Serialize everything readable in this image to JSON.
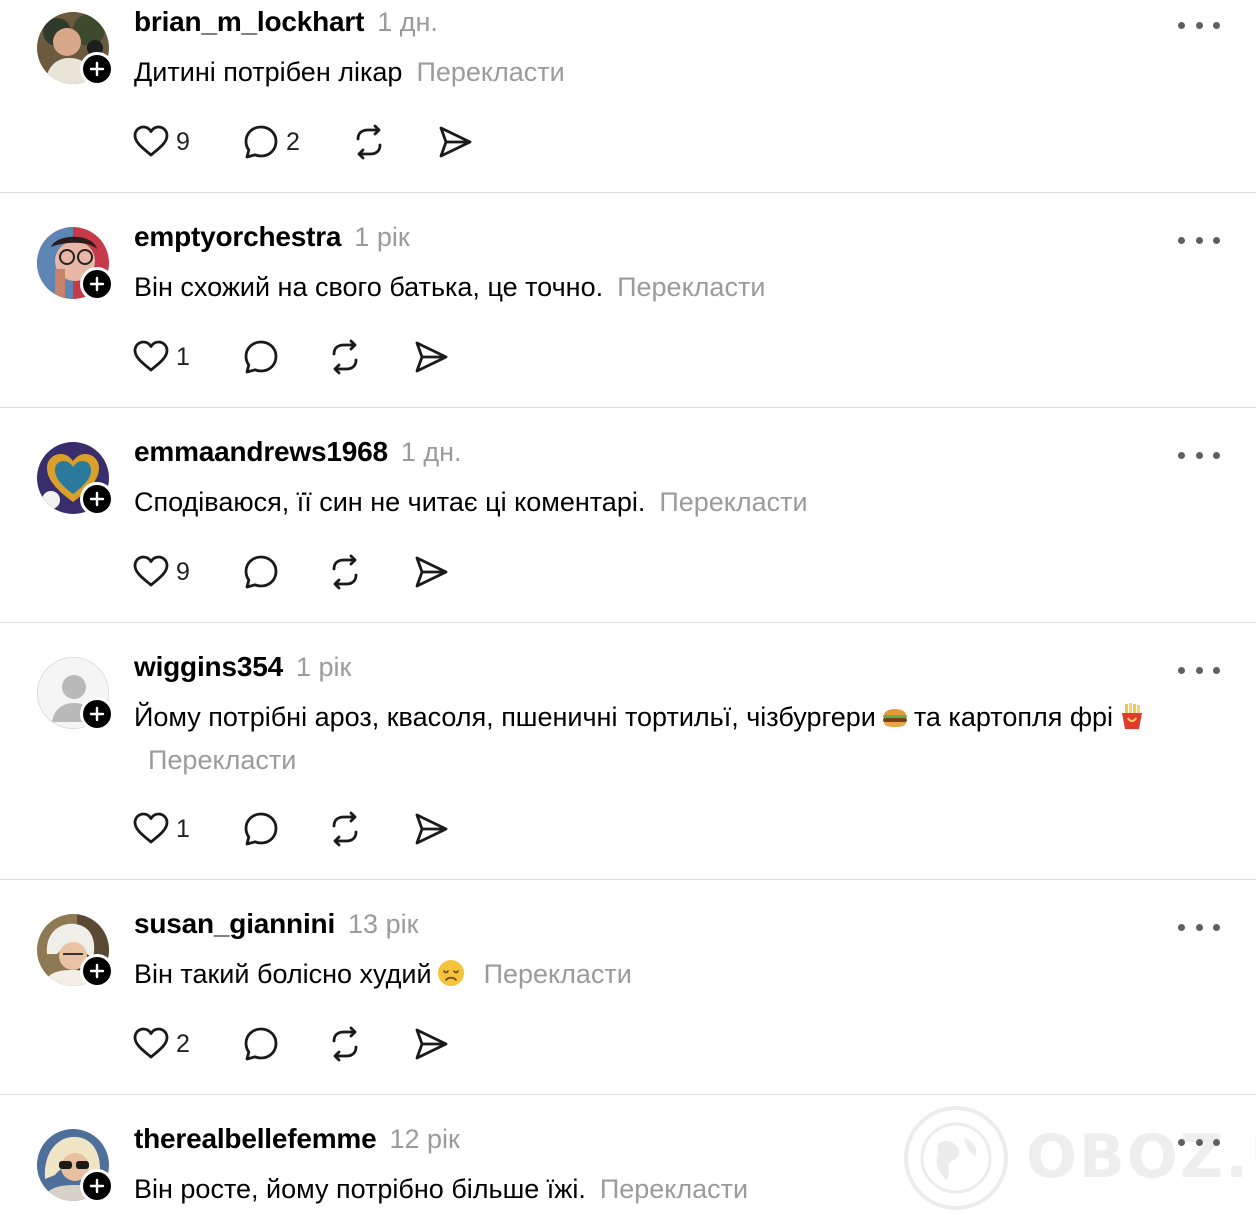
{
  "translate_label": "Перекласти",
  "posts": [
    {
      "username": "brian_m_lockhart",
      "time": "1 дн.",
      "text": "Дитині потрібен лікар",
      "likes": "9",
      "comments": "2"
    },
    {
      "username": "emptyorchestra",
      "time": "1 рік",
      "text": "Він схожий на свого батька, це точно.",
      "likes": "1",
      "comments": ""
    },
    {
      "username": "emmaandrews1968",
      "time": "1 дн.",
      "text": "Сподіваюся, її син не читає ці коментарі.",
      "likes": "9",
      "comments": ""
    },
    {
      "username": "wiggins354",
      "time": "1 рік",
      "text_part1": "Йому потрібні ароз, квасоля, пшеничні тортильї, чізбургери",
      "text_part2": "та картопля фрі",
      "likes": "1",
      "comments": ""
    },
    {
      "username": "susan_giannini",
      "time": "13 рік",
      "text": "Він такий болісно худий",
      "likes": "2",
      "comments": ""
    },
    {
      "username": "therealbellefemme",
      "time": "12 рік",
      "text": "Він росте, йому потрібно більше їжі."
    }
  ],
  "icons": {
    "like": "heart-icon",
    "comment": "comment-bubble-icon",
    "repost": "repost-icon",
    "share": "send-icon",
    "more": "more-dots-icon",
    "follow": "plus-icon"
  },
  "emojis": [
    "hamburger",
    "french-fries",
    "disappointed-face"
  ],
  "watermark_text": "OBOZ.UA"
}
